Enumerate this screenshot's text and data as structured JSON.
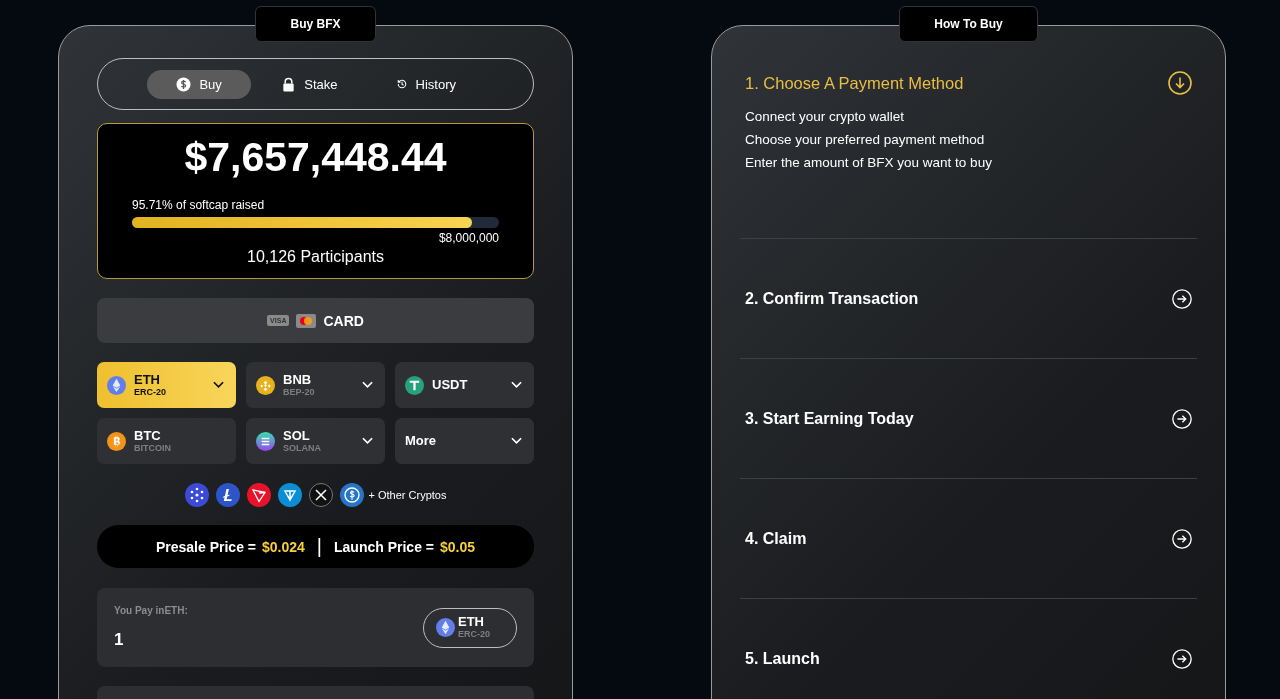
{
  "buy_panel": {
    "title": "Buy BFX",
    "tabs": [
      {
        "kind": "dollar",
        "label": "Buy",
        "selected": true
      },
      {
        "kind": "lock",
        "label": "Stake",
        "selected": false
      },
      {
        "kind": "history",
        "label": "History",
        "selected": false
      }
    ],
    "raised": {
      "amount": "$7,657,448.44",
      "caption": "95.71% of softcap raised",
      "level": 0.927,
      "target": "$8,000,000",
      "participants": "10,126 Participants"
    },
    "card_button": {
      "visa": "VISA",
      "label": "CARD"
    },
    "currencies": [
      {
        "kind": "eth",
        "symbol": "ETH",
        "network": "ERC-20",
        "selected": true,
        "dropdown": true
      },
      {
        "kind": "bnb",
        "symbol": "BNB",
        "network": "BEP-20",
        "selected": false,
        "dropdown": true
      },
      {
        "kind": "usdt",
        "symbol": "USDT",
        "selected": false,
        "dropdown": true
      },
      {
        "kind": "btc",
        "symbol": "BTC",
        "network": "BITCOIN",
        "selected": false,
        "dropdown": false
      },
      {
        "kind": "sol",
        "symbol": "SOL",
        "network": "SOLANA",
        "selected": false,
        "dropdown": true
      },
      {
        "kind": "more",
        "symbol": "More",
        "selected": false,
        "dropdown": true
      }
    ],
    "other_cryptos": "+ Other Cryptos",
    "prices": {
      "presale_label": "Presale Price =",
      "presale_value": "$0.024",
      "separator": "|",
      "launch_label": "Launch Price =",
      "launch_value": "$0.05"
    },
    "pay": {
      "label": "You Pay inETH:",
      "value": "1",
      "token": {
        "symbol": "ETH",
        "network": "ERC-20"
      }
    }
  },
  "how_to_buy": {
    "title": "How To Buy",
    "steps": [
      {
        "title": "1. Choose A Payment Method",
        "expanded": true,
        "lines": [
          "Connect your crypto wallet",
          "Choose your preferred payment method",
          "Enter the amount of BFX you want to buy"
        ]
      },
      {
        "title": "2. Confirm Transaction",
        "expanded": false
      },
      {
        "title": "3. Start Earning Today",
        "expanded": false
      },
      {
        "title": "4. Claim",
        "expanded": false
      },
      {
        "title": "5. Launch",
        "expanded": false
      }
    ]
  }
}
